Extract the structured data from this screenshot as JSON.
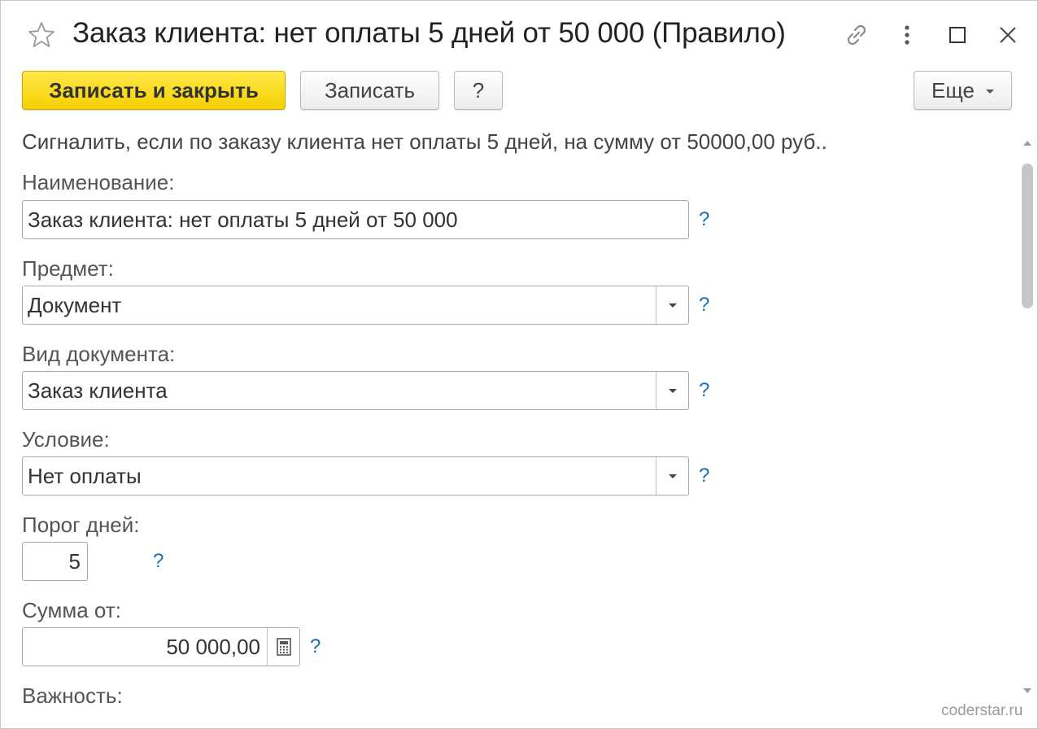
{
  "window": {
    "title": "Заказ клиента: нет оплаты 5 дней от 50 000 (Правило)",
    "icons": [
      "star-icon",
      "link-icon",
      "more-vertical-icon",
      "maximize-icon",
      "close-icon"
    ]
  },
  "toolbar": {
    "save_close_label": "Записать и закрыть",
    "save_label": "Записать",
    "help_label": "?",
    "more_label": "Еще"
  },
  "description": "Сигналить, если по заказу клиента нет оплаты 5 дней, на сумму от 50000,00 руб..",
  "form": {
    "name": {
      "label": "Наименование:",
      "value": "Заказ клиента: нет оплаты 5 дней от 50 000",
      "help": "?"
    },
    "subject": {
      "label": "Предмет:",
      "value": "Документ",
      "help": "?"
    },
    "doc_type": {
      "label": "Вид документа:",
      "value": "Заказ клиента",
      "help": "?"
    },
    "condition": {
      "label": "Условие:",
      "value": "Нет оплаты",
      "help": "?"
    },
    "days": {
      "label": "Порог дней:",
      "value": "5",
      "help": "?"
    },
    "amount": {
      "label": "Сумма от:",
      "value": "50 000,00",
      "help": "?"
    },
    "importance": {
      "label": "Важность:"
    }
  },
  "watermark": "coderstar.ru",
  "colors": {
    "primary_button": "#f5d000",
    "help_link": "#1a6fb0"
  }
}
